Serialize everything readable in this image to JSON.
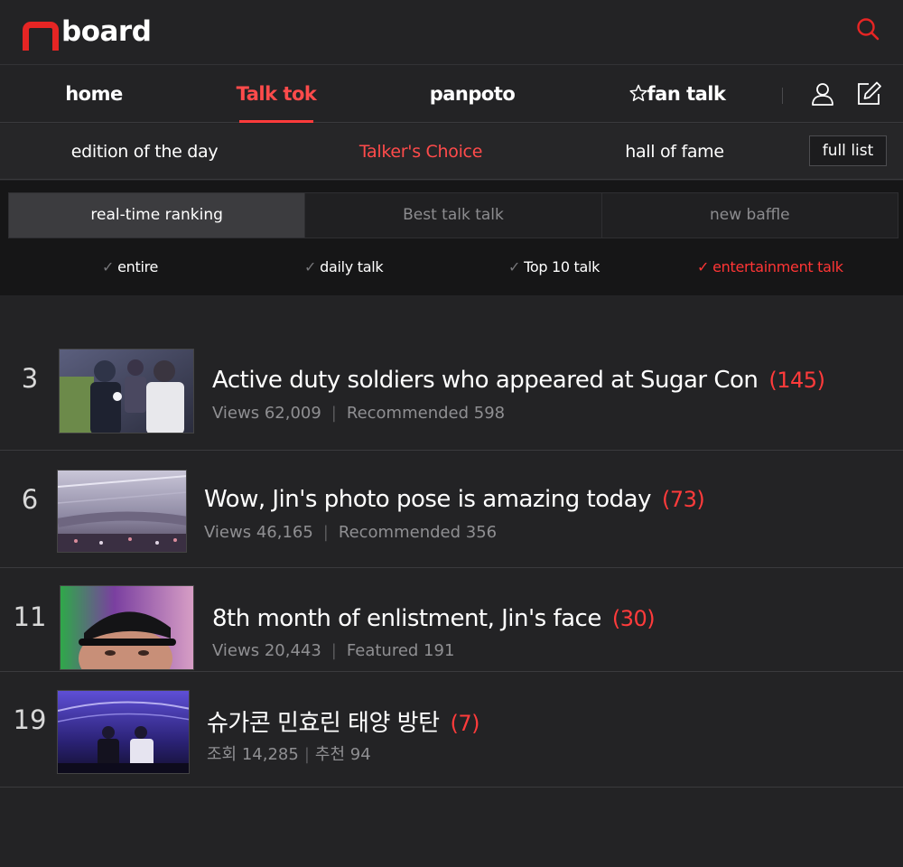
{
  "header": {
    "logo_text": "board",
    "search_icon": "search-icon"
  },
  "nav": {
    "items": [
      {
        "label": "home",
        "active": false
      },
      {
        "label": "Talk tok",
        "active": true
      },
      {
        "label": "panpoto",
        "active": false
      },
      {
        "label": "fan talk",
        "active": false,
        "icon": "star-icon"
      }
    ],
    "user_icon": "user-icon",
    "write_icon": "edit-icon"
  },
  "subnav": {
    "items": [
      {
        "label": "edition of the day",
        "active": false
      },
      {
        "label": "Talker's Choice",
        "active": true
      },
      {
        "label": "hall of fame",
        "active": false
      }
    ],
    "full_list_label": "full list"
  },
  "tabs": [
    {
      "label": "real-time ranking",
      "active": true
    },
    {
      "label": "Best talk talk",
      "active": false
    },
    {
      "label": "new baffle",
      "active": false
    }
  ],
  "filters": [
    {
      "label": "entire",
      "active": false
    },
    {
      "label": "daily talk",
      "active": false
    },
    {
      "label": "Top 10 talk",
      "active": false
    },
    {
      "label": "entertainment talk",
      "active": true
    }
  ],
  "posts": [
    {
      "rank": "3",
      "title": "Active duty soldiers who appeared at Sugar Con",
      "comments": "(145)",
      "meta1": "Views 62,009",
      "meta2": "Recommended 598"
    },
    {
      "rank": "6",
      "title": "Wow, Jin's photo pose is amazing today",
      "comments": "(73)",
      "meta1": "Views 46,165",
      "meta2": "Recommended 356"
    },
    {
      "rank": "11",
      "title": "8th month of enlistment, Jin's face",
      "comments": "(30)",
      "meta1": "Views 20,443",
      "meta2": "Featured 191"
    },
    {
      "rank": "19",
      "title": "슈가콘 민효린 태양 방탄",
      "comments": "(7)",
      "meta1": "조회 14,285",
      "meta2": "추천 94"
    }
  ],
  "colors": {
    "accent": "#ff3b3b",
    "logo": "#e62524",
    "background": "#232325",
    "band": "#161617"
  }
}
